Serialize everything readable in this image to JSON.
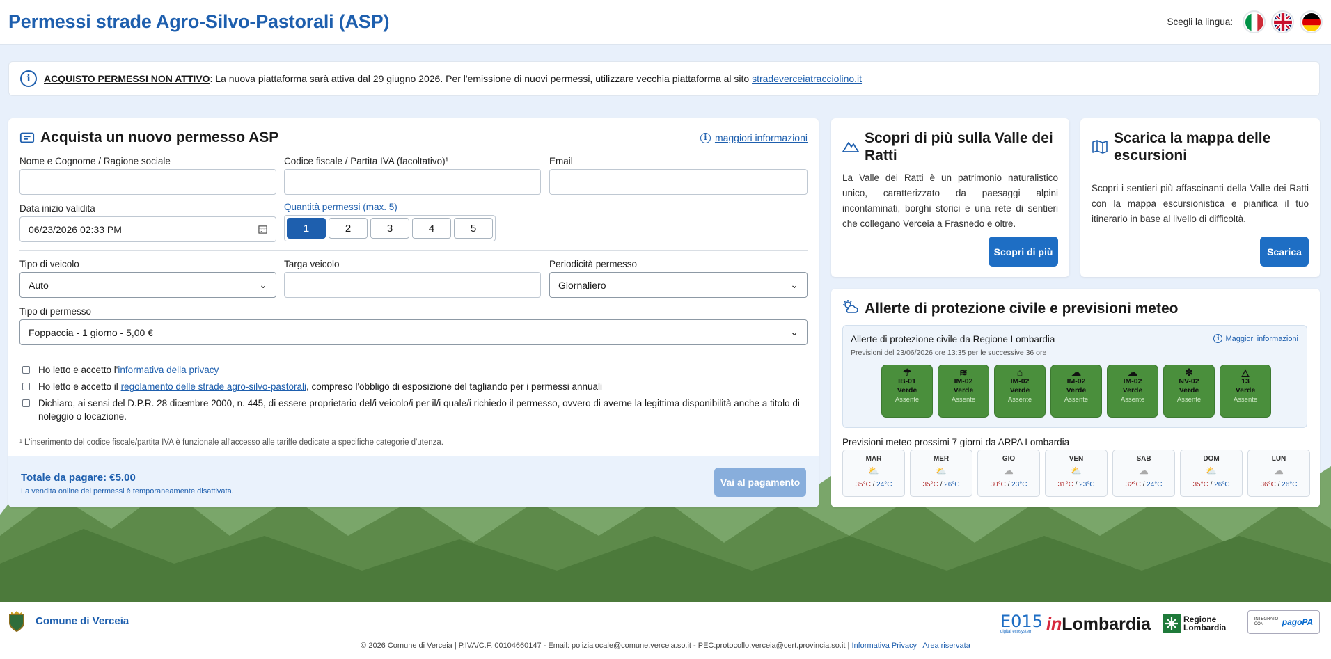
{
  "header": {
    "title": "Permessi strade Agro-Silvo-Pastorali (ASP)",
    "lang_label": "Scegli la lingua:"
  },
  "notice": {
    "bold": "ACQUISTO PERMESSI NON ATTIVO",
    "text": ": La nuova piattaforma sarà attiva dal 29 giugno 2026. Per l'emissione di nuovi permessi, utilizzare vecchia piattaforma al sito ",
    "link": "stradeverceiatracciolino.it"
  },
  "form": {
    "title": "Acquista un nuovo permesso ASP",
    "more_info": "maggiori informazioni",
    "name_label": "Nome e Cognome / Ragione sociale",
    "cf_label": "Codice fiscale / Partita IVA (facoltativo)¹",
    "email_label": "Email",
    "date_label": "Data inizio validita",
    "date_value": "06/23/2026 02:33 PM",
    "qty_label": "Quantità permessi (max. 5)",
    "qty_options": [
      "1",
      "2",
      "3",
      "4",
      "5"
    ],
    "vehicle_label": "Tipo di veicolo",
    "vehicle_value": "Auto",
    "plate_label": "Targa veicolo",
    "period_label": "Periodicità permesso",
    "period_value": "Giornaliero",
    "permit_label": "Tipo di permesso",
    "permit_value": "Foppaccia - 1 giorno - 5,00 €",
    "privacy_pre": "Ho letto e accetto l'",
    "privacy_link": "informativa della privacy",
    "rules_pre": "Ho letto e accetto il ",
    "rules_link": "regolamento delle strade agro-silvo-pastorali",
    "rules_post": ", compreso l'obbligo di esposizione del tagliando per i permessi annuali",
    "dpr_text": "Dichiaro, ai sensi del D.P.R. 28 dicembre 2000, n. 445, di essere proprietario del/i veicolo/i per il/i quale/i richiedo il permesso, ovvero di averne la legittima disponibilità anche a titolo di noleggio o locazione.",
    "footnote": "¹ L'inserimento del codice fiscale/partita IVA è funzionale all'accesso alle tariffe dedicate a specifiche categorie d'utenza.",
    "total": "Totale da pagare: €5.00",
    "total_sub": "La vendita online dei permessi è temporaneamente disattivata.",
    "pay_button": "Vai al pagamento"
  },
  "discover": {
    "title": "Scopri di più sulla Valle dei Ratti",
    "text": "La Valle dei Ratti è un patrimonio naturalistico unico, caratterizzato da paesaggi alpini incontaminati, borghi storici e una rete di sentieri che collegano Verceia a Frasnedo e oltre.",
    "button": "Scopri di più"
  },
  "map": {
    "title": "Scarica la mappa delle escursioni",
    "text": "Scopri i sentieri più affascinanti della Valle dei Ratti con la mappa escursionistica e pianifica il tuo itinerario in base al livello di difficoltà.",
    "button": "Scarica"
  },
  "alerts": {
    "title": "Allerte di protezione civile e previsioni meteo",
    "box_title": "Allerte di protezione civile da Regione Lombardia",
    "box_more": "Maggiori informazioni",
    "box_sub": "Previsioni del 23/06/2026 ore 13:35 per le successive 36 ore",
    "badges": [
      {
        "code": "IB-01",
        "level": "Verde",
        "status": "Assente"
      },
      {
        "code": "IM-02",
        "level": "Verde",
        "status": "Assente"
      },
      {
        "code": "IM-02",
        "level": "Verde",
        "status": "Assente"
      },
      {
        "code": "IM-02",
        "level": "Verde",
        "status": "Assente"
      },
      {
        "code": "IM-02",
        "level": "Verde",
        "status": "Assente"
      },
      {
        "code": "NV-02",
        "level": "Verde",
        "status": "Assente"
      },
      {
        "code": "13",
        "level": "Verde",
        "status": "Assente"
      }
    ],
    "forecast_title": "Previsioni meteo prossimi 7 giorni da ARPA Lombardia",
    "days": [
      {
        "d": "MAR",
        "hi": "35°C",
        "lo": "24°C"
      },
      {
        "d": "MER",
        "hi": "35°C",
        "lo": "26°C"
      },
      {
        "d": "GIO",
        "hi": "30°C",
        "lo": "23°C"
      },
      {
        "d": "VEN",
        "hi": "31°C",
        "lo": "23°C"
      },
      {
        "d": "SAB",
        "hi": "32°C",
        "lo": "24°C"
      },
      {
        "d": "DOM",
        "hi": "35°C",
        "lo": "26°C"
      },
      {
        "d": "LUN",
        "hi": "36°C",
        "lo": "26°C"
      }
    ]
  },
  "footer": {
    "municipality": "Comune di Verceia",
    "e015": "E015",
    "e015_sub": "digital ecosystem",
    "inlombardia": "Lombardia",
    "in_prefix": "in",
    "regione": "Regione",
    "regione2": "Lombardia",
    "pagopa_pre": "INTEGRATO CON",
    "pagopa": "pagoPA",
    "copy": "© 2026 Comune di Verceia | P.IVA/C.F. 00104660147 - Email: polizialocale@comune.verceia.so.it - PEC:protocollo.verceia@cert.provincia.so.it | ",
    "privacy": "Informativa Privacy",
    "sep": " | ",
    "reserved": "Area riservata"
  }
}
